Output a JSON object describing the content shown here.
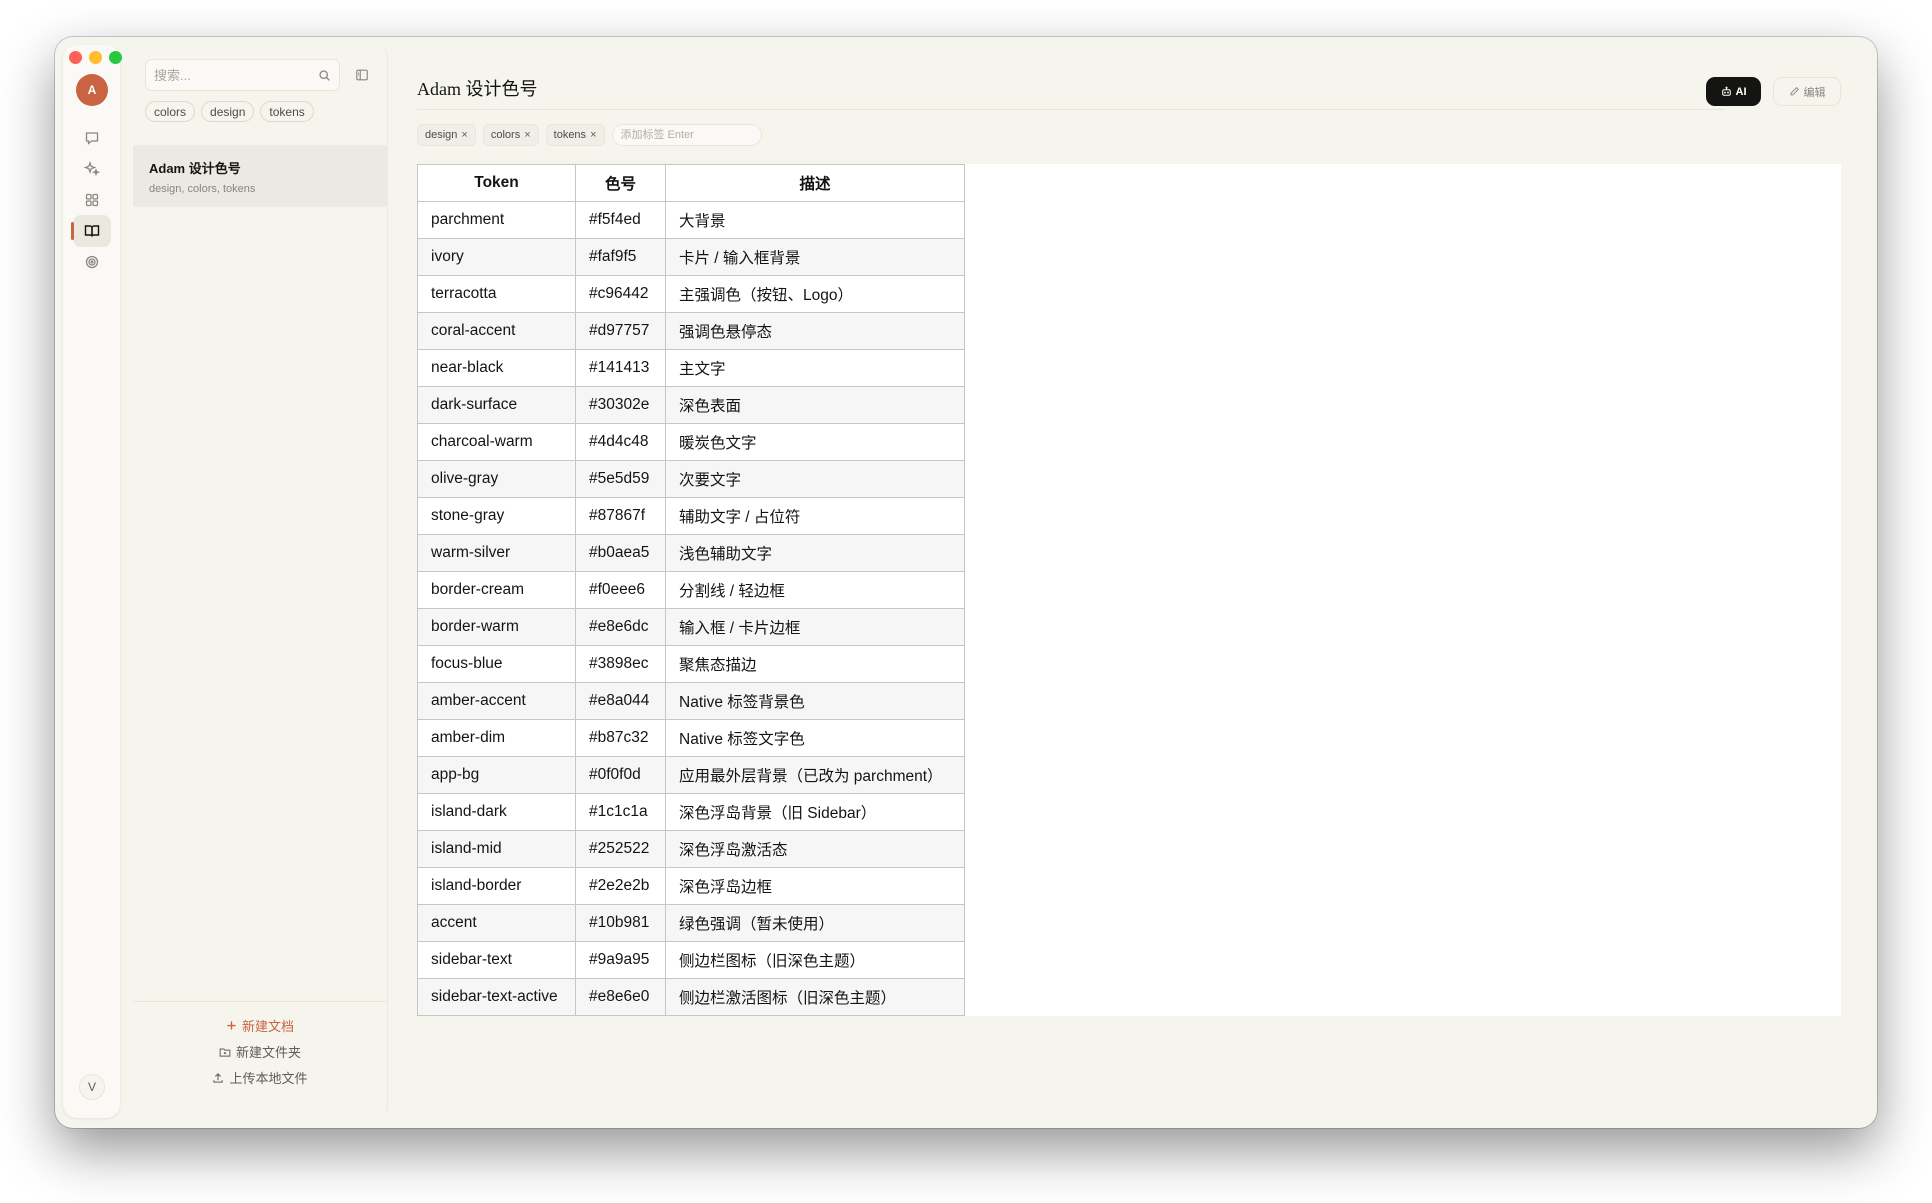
{
  "rail": {
    "avatar_initial": "A",
    "user_initial": "V",
    "items": [
      "chat-icon",
      "sparkles-icon",
      "apps-grid-icon",
      "book-open-icon",
      "target-icon"
    ],
    "active_item": "book-open-icon",
    "accent": "#c96442"
  },
  "sidebar": {
    "search_placeholder": "搜索...",
    "filter_tags": [
      "colors",
      "design",
      "tokens"
    ],
    "documents": [
      {
        "title": "Adam 设计色号",
        "tags": "design, colors, tokens"
      }
    ],
    "new_doc_label": "新建文档",
    "new_folder_label": "新建文件夹",
    "upload_label": "上传本地文件"
  },
  "header": {
    "title": "Adam 设计色号",
    "ai_label": "AI",
    "edit_label": "编辑"
  },
  "tags": {
    "items": [
      "design",
      "colors",
      "tokens"
    ],
    "remove_glyph": "×",
    "input_placeholder": "添加标签 Enter"
  },
  "table": {
    "headers": [
      "Token",
      "色号",
      "描述"
    ],
    "rows": [
      [
        "parchment",
        "#f5f4ed",
        "大背景"
      ],
      [
        "ivory",
        "#faf9f5",
        "卡片 / 输入框背景"
      ],
      [
        "terracotta",
        "#c96442",
        "主强调色（按钮、Logo）"
      ],
      [
        "coral-accent",
        "#d97757",
        "强调色悬停态"
      ],
      [
        "near-black",
        "#141413",
        "主文字"
      ],
      [
        "dark-surface",
        "#30302e",
        "深色表面"
      ],
      [
        "charcoal-warm",
        "#4d4c48",
        "暖炭色文字"
      ],
      [
        "olive-gray",
        "#5e5d59",
        "次要文字"
      ],
      [
        "stone-gray",
        "#87867f",
        "辅助文字 / 占位符"
      ],
      [
        "warm-silver",
        "#b0aea5",
        "浅色辅助文字"
      ],
      [
        "border-cream",
        "#f0eee6",
        "分割线 / 轻边框"
      ],
      [
        "border-warm",
        "#e8e6dc",
        "输入框 / 卡片边框"
      ],
      [
        "focus-blue",
        "#3898ec",
        "聚焦态描边"
      ],
      [
        "amber-accent",
        "#e8a044",
        "Native 标签背景色"
      ],
      [
        "amber-dim",
        "#b87c32",
        "Native 标签文字色"
      ],
      [
        "app-bg",
        "#0f0f0d",
        "应用最外层背景（已改为 parchment）"
      ],
      [
        "island-dark",
        "#1c1c1a",
        "深色浮岛背景（旧 Sidebar）"
      ],
      [
        "island-mid",
        "#252522",
        "深色浮岛激活态"
      ],
      [
        "island-border",
        "#2e2e2b",
        "深色浮岛边框"
      ],
      [
        "accent",
        "#10b981",
        "绿色强调（暂未使用）"
      ],
      [
        "sidebar-text",
        "#9a9a95",
        "侧边栏图标（旧深色主题）"
      ],
      [
        "sidebar-text-active",
        "#e8e6e0",
        "侧边栏激活图标（旧深色主题）"
      ]
    ]
  }
}
